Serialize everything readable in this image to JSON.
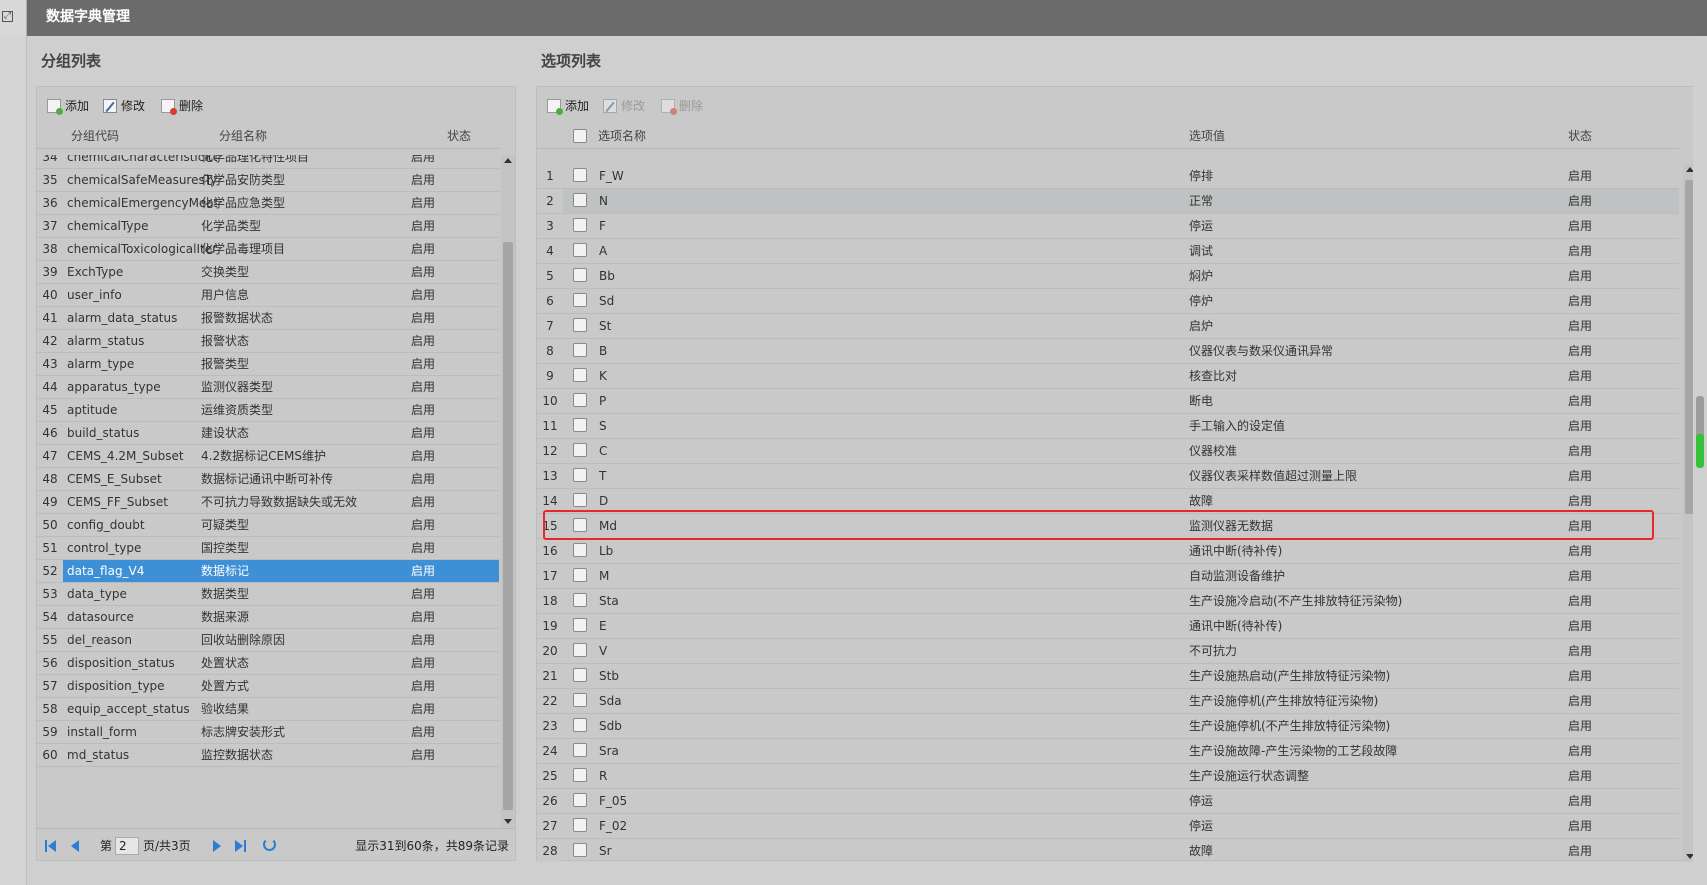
{
  "app": {
    "title": "数据字典管理"
  },
  "left": {
    "section_title": "分组列表",
    "toolbar": {
      "add": "添加",
      "edit": "修改",
      "delete": "删除"
    },
    "columns": {
      "code": "分组代码",
      "name": "分组名称",
      "status": "状态"
    },
    "rows": [
      {
        "n": "34",
        "code": "chemicalCharacteristicIte",
        "name": "化学品理化特性项目",
        "status": "启用"
      },
      {
        "n": "35",
        "code": "chemicalSafeMeasuresTy",
        "name": "化学品安防类型",
        "status": "启用"
      },
      {
        "n": "36",
        "code": "chemicalEmergencyMeas",
        "name": "化学品应急类型",
        "status": "启用"
      },
      {
        "n": "37",
        "code": "chemicalType",
        "name": "化学品类型",
        "status": "启用"
      },
      {
        "n": "38",
        "code": "chemicalToxicologicalIter",
        "name": "化学品毒理项目",
        "status": "启用"
      },
      {
        "n": "39",
        "code": "ExchType",
        "name": "交换类型",
        "status": "启用"
      },
      {
        "n": "40",
        "code": "user_info",
        "name": "用户信息",
        "status": "启用"
      },
      {
        "n": "41",
        "code": "alarm_data_status",
        "name": "报警数据状态",
        "status": "启用"
      },
      {
        "n": "42",
        "code": "alarm_status",
        "name": "报警状态",
        "status": "启用"
      },
      {
        "n": "43",
        "code": "alarm_type",
        "name": "报警类型",
        "status": "启用"
      },
      {
        "n": "44",
        "code": "apparatus_type",
        "name": "监测仪器类型",
        "status": "启用"
      },
      {
        "n": "45",
        "code": "aptitude",
        "name": "运维资质类型",
        "status": "启用"
      },
      {
        "n": "46",
        "code": "build_status",
        "name": "建设状态",
        "status": "启用"
      },
      {
        "n": "47",
        "code": "CEMS_4.2M_Subset",
        "name": "4.2数据标记CEMS维护",
        "status": "启用"
      },
      {
        "n": "48",
        "code": "CEMS_E_Subset",
        "name": "数据标记通讯中断可补传",
        "status": "启用"
      },
      {
        "n": "49",
        "code": "CEMS_FF_Subset",
        "name": "不可抗力导致数据缺失或无效",
        "status": "启用"
      },
      {
        "n": "50",
        "code": "config_doubt",
        "name": "可疑类型",
        "status": "启用"
      },
      {
        "n": "51",
        "code": "control_type",
        "name": "国控类型",
        "status": "启用"
      },
      {
        "n": "52",
        "code": "data_flag_V4",
        "name": "数据标记",
        "status": "启用"
      },
      {
        "n": "53",
        "code": "data_type",
        "name": "数据类型",
        "status": "启用"
      },
      {
        "n": "54",
        "code": "datasource",
        "name": "数据来源",
        "status": "启用"
      },
      {
        "n": "55",
        "code": "del_reason",
        "name": "回收站删除原因",
        "status": "启用"
      },
      {
        "n": "56",
        "code": "disposition_status",
        "name": "处置状态",
        "status": "启用"
      },
      {
        "n": "57",
        "code": "disposition_type",
        "name": "处置方式",
        "status": "启用"
      },
      {
        "n": "58",
        "code": "equip_accept_status",
        "name": "验收结果",
        "status": "启用"
      },
      {
        "n": "59",
        "code": "install_form",
        "name": "标志牌安装形式",
        "status": "启用"
      },
      {
        "n": "60",
        "code": "md_status",
        "name": "监控数据状态",
        "status": "启用"
      }
    ],
    "pager": {
      "page_prefix": "第",
      "page_value": "2",
      "page_suffix": "页/共3页",
      "summary": "显示31到60条，共89条记录"
    }
  },
  "right": {
    "section_title": "选项列表",
    "toolbar": {
      "add": "添加",
      "edit": "修改",
      "delete": "删除"
    },
    "columns": {
      "name": "选项名称",
      "value": "选项值",
      "status": "状态"
    },
    "rows": [
      {
        "n": "1",
        "name": "F_W",
        "value": "停排",
        "status": "启用"
      },
      {
        "n": "2",
        "name": "N",
        "value": "正常",
        "status": "启用"
      },
      {
        "n": "3",
        "name": "F",
        "value": "停运",
        "status": "启用"
      },
      {
        "n": "4",
        "name": "A",
        "value": "调试",
        "status": "启用"
      },
      {
        "n": "5",
        "name": "Bb",
        "value": "焖炉",
        "status": "启用"
      },
      {
        "n": "6",
        "name": "Sd",
        "value": "停炉",
        "status": "启用"
      },
      {
        "n": "7",
        "name": "St",
        "value": "启炉",
        "status": "启用"
      },
      {
        "n": "8",
        "name": "B",
        "value": "仪器仪表与数采仪通讯异常",
        "status": "启用"
      },
      {
        "n": "9",
        "name": "K",
        "value": "核查比对",
        "status": "启用"
      },
      {
        "n": "10",
        "name": "P",
        "value": "断电",
        "status": "启用"
      },
      {
        "n": "11",
        "name": "S",
        "value": "手工输入的设定值",
        "status": "启用"
      },
      {
        "n": "12",
        "name": "C",
        "value": "仪器校准",
        "status": "启用"
      },
      {
        "n": "13",
        "name": "T",
        "value": "仪器仪表采样数值超过测量上限",
        "status": "启用"
      },
      {
        "n": "14",
        "name": "D",
        "value": "故障",
        "status": "启用"
      },
      {
        "n": "15",
        "name": "Md",
        "value": "监测仪器无数据",
        "status": "启用"
      },
      {
        "n": "16",
        "name": "Lb",
        "value": "通讯中断(待补传)",
        "status": "启用"
      },
      {
        "n": "17",
        "name": "M",
        "value": "自动监测设备维护",
        "status": "启用"
      },
      {
        "n": "18",
        "name": "Sta",
        "value": "生产设施冷启动(不产生排放特征污染物)",
        "status": "启用"
      },
      {
        "n": "19",
        "name": "E",
        "value": "通讯中断(待补传)",
        "status": "启用"
      },
      {
        "n": "20",
        "name": "V",
        "value": "不可抗力",
        "status": "启用"
      },
      {
        "n": "21",
        "name": "Stb",
        "value": "生产设施热启动(产生排放特征污染物)",
        "status": "启用"
      },
      {
        "n": "22",
        "name": "Sda",
        "value": "生产设施停机(产生排放特征污染物)",
        "status": "启用"
      },
      {
        "n": "23",
        "name": "Sdb",
        "value": "生产设施停机(不产生排放特征污染物)",
        "status": "启用"
      },
      {
        "n": "24",
        "name": "Sra",
        "value": "生产设施故障-产生污染物的工艺段故障",
        "status": "启用"
      },
      {
        "n": "25",
        "name": "R",
        "value": "生产设施运行状态调整",
        "status": "启用"
      },
      {
        "n": "26",
        "name": "F_05",
        "value": "停运",
        "status": "启用"
      },
      {
        "n": "27",
        "name": "F_02",
        "value": "停运",
        "status": "启用"
      },
      {
        "n": "28",
        "name": "Sr",
        "value": "故障",
        "status": "启用"
      }
    ]
  }
}
